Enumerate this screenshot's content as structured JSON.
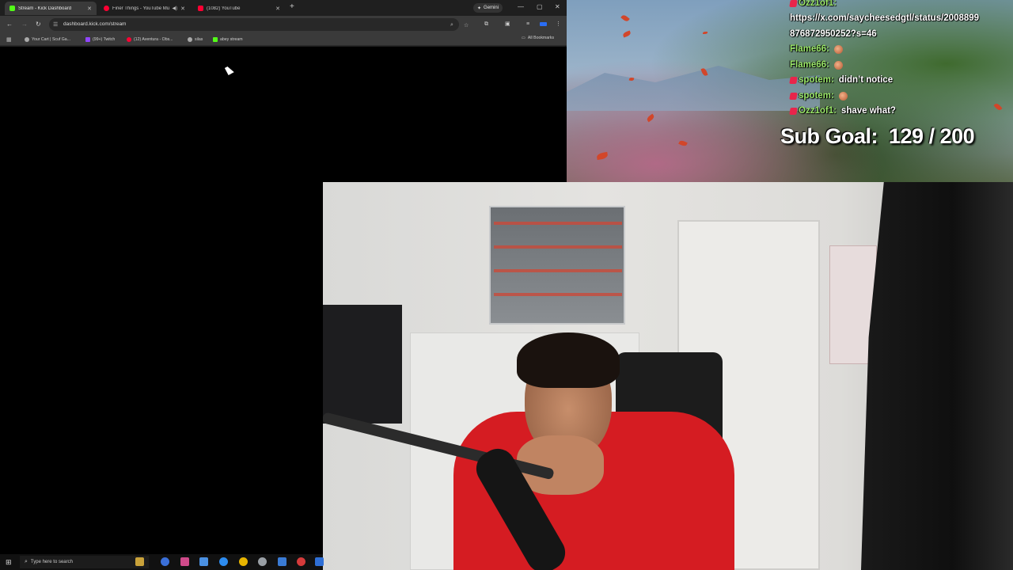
{
  "browser": {
    "tabs": [
      {
        "title": "Stream - Kick Dashboard",
        "active": true,
        "favicon_color": "#53fc18"
      },
      {
        "title": "Finer Things - YouTube Mu",
        "active": false,
        "favicon_color": "#ff0033",
        "audio": true
      },
      {
        "title": "(1082) YouTube",
        "active": false,
        "favicon_color": "#ff0033"
      }
    ],
    "gemini_label": "Gemini",
    "url": "dashboard.kick.com/stream",
    "bookmarks": [
      {
        "label": "Your Cart | Scuf Ga...",
        "icon_color": "#aaaaaa"
      },
      {
        "label": "(99+) Twitch",
        "icon_color": "#9146ff"
      },
      {
        "label": "(12) Aventura - Obs...",
        "icon_color": "#ff0033"
      },
      {
        "label": "silas",
        "icon_color": "#aaaaaa"
      },
      {
        "label": "abey stream",
        "icon_color": "#53fc18"
      }
    ],
    "all_bookmarks_label": "All Bookmarks"
  },
  "chat": {
    "lines": [
      {
        "user": "Ozz1of1:",
        "text": ""
      },
      {
        "user": "",
        "text": "https://x.com/saycheesedgtl/status/2008899"
      },
      {
        "user": "",
        "text": "876872950252?s=46"
      },
      {
        "user": "Flame66:",
        "text": "",
        "emote": true
      },
      {
        "user": "Flame66:",
        "text": "",
        "emote": true
      },
      {
        "user": "spotem:",
        "text": "didn’t notice"
      },
      {
        "user": "spotem:",
        "text": "",
        "emote": true
      },
      {
        "user": "Ozz1of1:",
        "text": "shave what?"
      }
    ]
  },
  "subgoal": {
    "label": "Sub Goal:",
    "value": "129 / 200"
  },
  "taskbar": {
    "search_placeholder": "Type here to search"
  }
}
